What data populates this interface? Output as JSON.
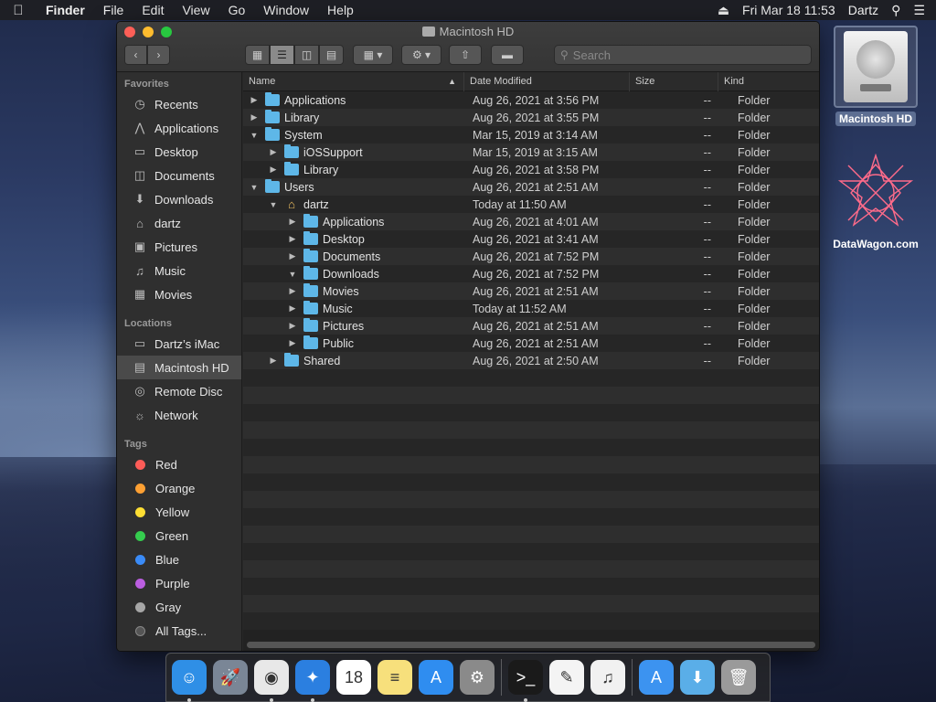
{
  "menubar": {
    "app": "Finder",
    "items": [
      "File",
      "Edit",
      "View",
      "Go",
      "Window",
      "Help"
    ],
    "clock": "Fri Mar 18  11:53",
    "user": "Dartz"
  },
  "window": {
    "title": "Macintosh HD",
    "search_placeholder": "Search"
  },
  "sidebar": {
    "favorites_header": "Favorites",
    "favorites": [
      {
        "label": "Recents",
        "icon": "clock-icon"
      },
      {
        "label": "Applications",
        "icon": "applications-icon"
      },
      {
        "label": "Desktop",
        "icon": "desktop-icon"
      },
      {
        "label": "Documents",
        "icon": "document-icon"
      },
      {
        "label": "Downloads",
        "icon": "download-icon"
      },
      {
        "label": "dartz",
        "icon": "home-icon"
      },
      {
        "label": "Pictures",
        "icon": "camera-icon"
      },
      {
        "label": "Music",
        "icon": "music-note-icon"
      },
      {
        "label": "Movies",
        "icon": "film-icon"
      }
    ],
    "locations_header": "Locations",
    "locations": [
      {
        "label": "Dartz’s iMac",
        "icon": "imac-icon"
      },
      {
        "label": "Macintosh HD",
        "icon": "hard-drive-icon"
      },
      {
        "label": "Remote Disc",
        "icon": "disc-icon"
      },
      {
        "label": "Network",
        "icon": "globe-icon"
      }
    ],
    "tags_header": "Tags",
    "tags": [
      {
        "label": "Red",
        "color": "#fc5c57"
      },
      {
        "label": "Orange",
        "color": "#fda033"
      },
      {
        "label": "Yellow",
        "color": "#fdde33"
      },
      {
        "label": "Green",
        "color": "#35cc4e"
      },
      {
        "label": "Blue",
        "color": "#3a8bf7"
      },
      {
        "label": "Purple",
        "color": "#bb5ee0"
      },
      {
        "label": "Gray",
        "color": "#a6a6a6"
      },
      {
        "label": "All Tags...",
        "color": "#555555"
      }
    ]
  },
  "columns": {
    "name": "Name",
    "date": "Date Modified",
    "size": "Size",
    "kind": "Kind"
  },
  "rows": [
    {
      "name": "Applications",
      "date": "Aug 26, 2021 at 3:56 PM",
      "size": "--",
      "kind": "Folder",
      "level": 0,
      "open": false
    },
    {
      "name": "Library",
      "date": "Aug 26, 2021 at 3:55 PM",
      "size": "--",
      "kind": "Folder",
      "level": 0,
      "open": false
    },
    {
      "name": "System",
      "date": "Mar 15, 2019 at 3:14 AM",
      "size": "--",
      "kind": "Folder",
      "level": 0,
      "open": true
    },
    {
      "name": "iOSSupport",
      "date": "Mar 15, 2019 at 3:15 AM",
      "size": "--",
      "kind": "Folder",
      "level": 1,
      "open": false
    },
    {
      "name": "Library",
      "date": "Aug 26, 2021 at 3:58 PM",
      "size": "--",
      "kind": "Folder",
      "level": 1,
      "open": false
    },
    {
      "name": "Users",
      "date": "Aug 26, 2021 at 2:51 AM",
      "size": "--",
      "kind": "Folder",
      "level": 0,
      "open": true
    },
    {
      "name": "dartz",
      "date": "Today at 11:50 AM",
      "size": "--",
      "kind": "Folder",
      "level": 1,
      "open": true,
      "home": true
    },
    {
      "name": "Applications",
      "date": "Aug 26, 2021 at 4:01 AM",
      "size": "--",
      "kind": "Folder",
      "level": 2,
      "open": false
    },
    {
      "name": "Desktop",
      "date": "Aug 26, 2021 at 3:41 AM",
      "size": "--",
      "kind": "Folder",
      "level": 2,
      "open": false
    },
    {
      "name": "Documents",
      "date": "Aug 26, 2021 at 7:52 PM",
      "size": "--",
      "kind": "Folder",
      "level": 2,
      "open": false
    },
    {
      "name": "Downloads",
      "date": "Aug 26, 2021 at 7:52 PM",
      "size": "--",
      "kind": "Folder",
      "level": 2,
      "open": true
    },
    {
      "name": "Movies",
      "date": "Aug 26, 2021 at 2:51 AM",
      "size": "--",
      "kind": "Folder",
      "level": 2,
      "open": false
    },
    {
      "name": "Music",
      "date": "Today at 11:52 AM",
      "size": "--",
      "kind": "Folder",
      "level": 2,
      "open": false
    },
    {
      "name": "Pictures",
      "date": "Aug 26, 2021 at 2:51 AM",
      "size": "--",
      "kind": "Folder",
      "level": 2,
      "open": false
    },
    {
      "name": "Public",
      "date": "Aug 26, 2021 at 2:51 AM",
      "size": "--",
      "kind": "Folder",
      "level": 2,
      "open": false
    },
    {
      "name": "Shared",
      "date": "Aug 26, 2021 at 2:50 AM",
      "size": "--",
      "kind": "Folder",
      "level": 1,
      "open": false
    }
  ],
  "desktop": {
    "hd_label": "Macintosh HD",
    "datawagon_label": "DataWagon.com"
  },
  "dock": [
    {
      "name": "finder",
      "color": "#2f8fe6",
      "glyph": "☺",
      "running": true
    },
    {
      "name": "launchpad",
      "color": "#7a8696",
      "glyph": "🚀",
      "running": false
    },
    {
      "name": "chrome",
      "color": "#e8e8e8",
      "glyph": "◉",
      "running": true
    },
    {
      "name": "safari",
      "color": "#2b7fe0",
      "glyph": "✦",
      "running": true
    },
    {
      "name": "calendar",
      "color": "#ffffff",
      "glyph": "18",
      "running": false
    },
    {
      "name": "notes",
      "color": "#f7e07c",
      "glyph": "≡",
      "running": false
    },
    {
      "name": "app-store",
      "color": "#2f8df0",
      "glyph": "A",
      "running": false
    },
    {
      "name": "system-preferences",
      "color": "#8a8a8a",
      "glyph": "⚙",
      "running": false
    },
    {
      "name": "terminal",
      "color": "#1a1a1a",
      "glyph": ">_",
      "running": true
    },
    {
      "name": "textedit",
      "color": "#f4f4f4",
      "glyph": "✎",
      "running": false
    },
    {
      "name": "itunes",
      "color": "#f1f1f1",
      "glyph": "♫",
      "running": false
    },
    {
      "name": "app-store-folder",
      "color": "#3c93f0",
      "glyph": "A",
      "running": false
    },
    {
      "name": "downloads-folder",
      "color": "#5aaee8",
      "glyph": "⬇",
      "running": false
    },
    {
      "name": "trash",
      "color": "#9a9a9a",
      "glyph": "🗑",
      "running": false
    }
  ]
}
